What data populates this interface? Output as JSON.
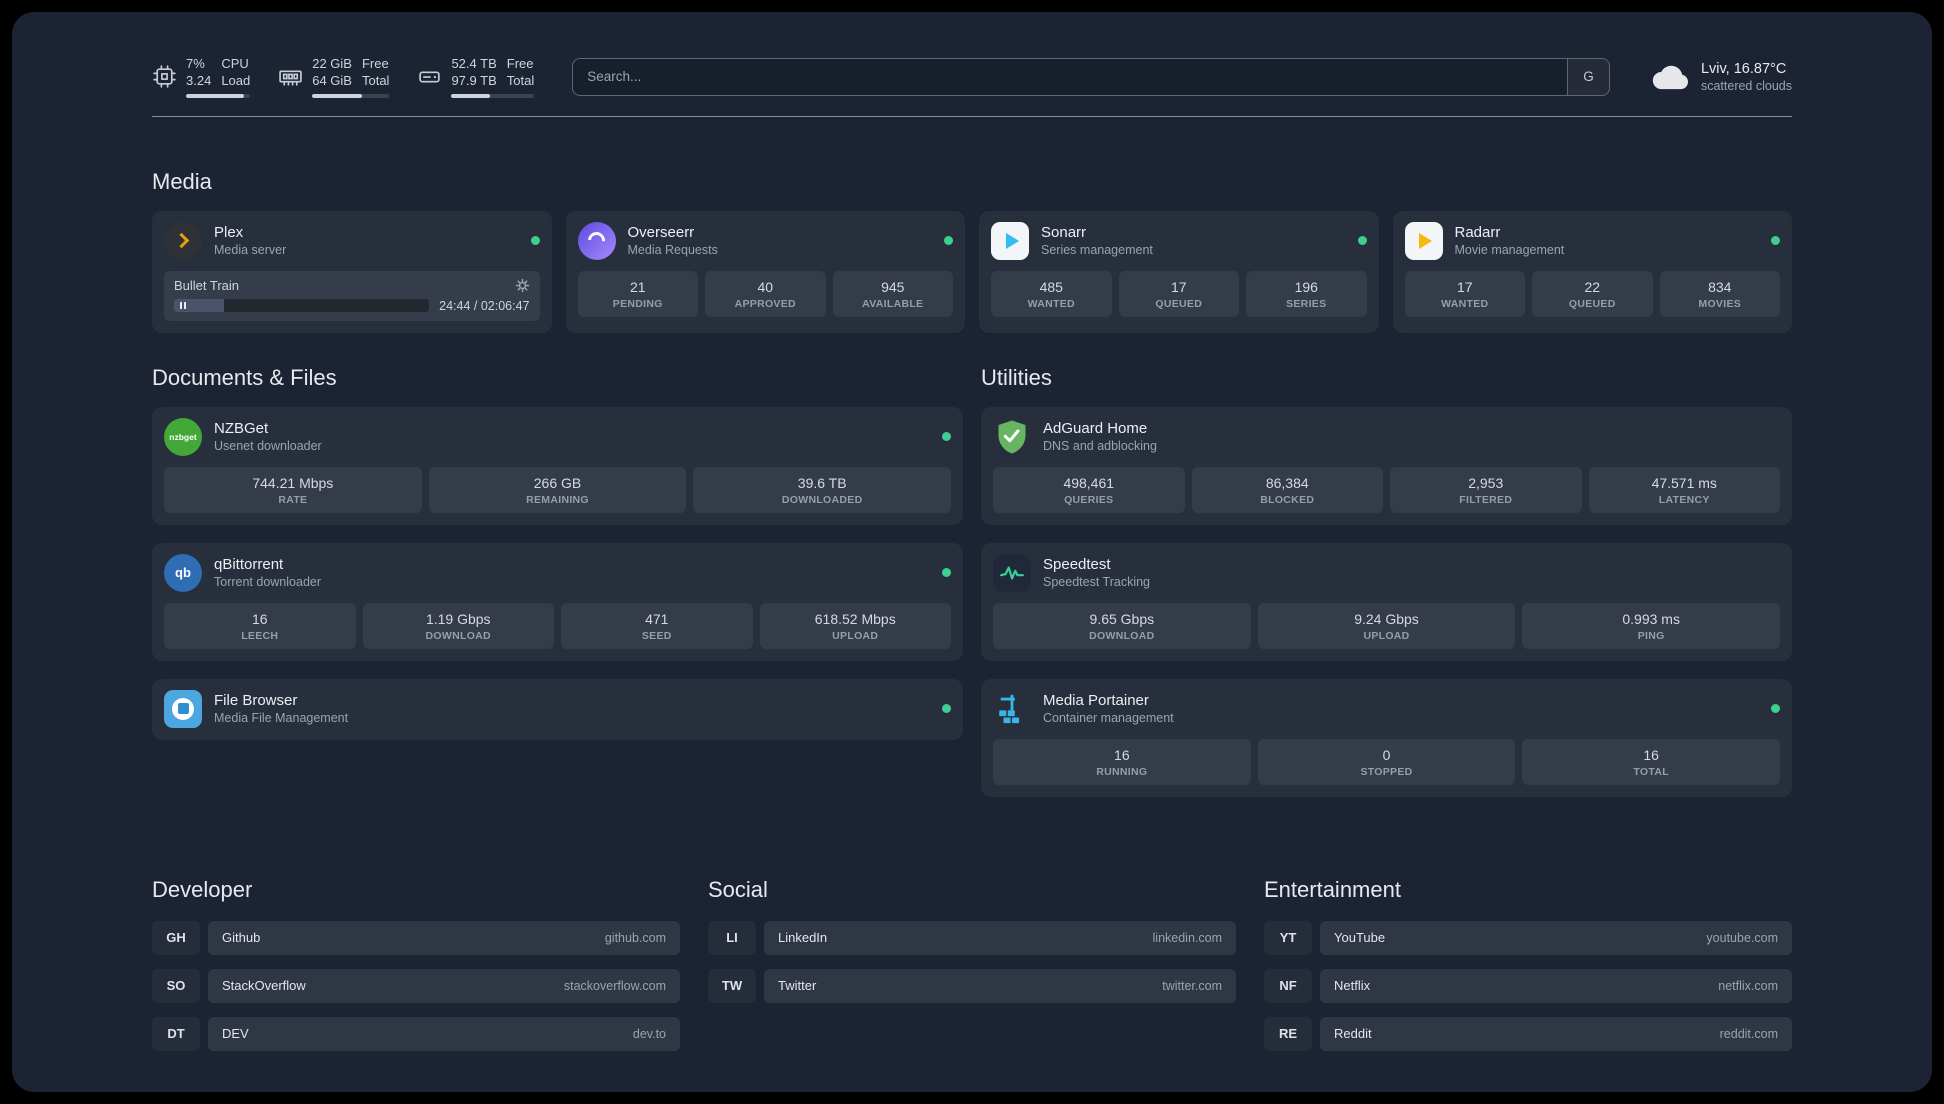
{
  "palette": {
    "background": "#1c2433",
    "status_green": "#3ecf8e",
    "plex_amber": "#e5a00d",
    "sonarr_blue": "#30bdf0",
    "radarr_yellow": "#f7b90c",
    "nzbget_green": "#44a839",
    "qbittorrent_blue": "#2f6db5",
    "filebrowser_blue": "#4ca6e0",
    "adguard_green": "#67b463",
    "speedtest_green": "#34d399",
    "portainer_blue": "#38b6e8"
  },
  "topbar": {
    "cpu": {
      "values": [
        "7%",
        "3.24"
      ],
      "labels": [
        "CPU",
        "Load"
      ],
      "percent": 90
    },
    "memory": {
      "values": [
        "22 GiB",
        "64 GiB"
      ],
      "labels": [
        "Free",
        "Total"
      ],
      "percent": 65
    },
    "disk": {
      "values": [
        "52.4 TB",
        "97.9 TB"
      ],
      "labels": [
        "Free",
        "Total"
      ],
      "percent": 46
    },
    "search": {
      "placeholder": "Search...",
      "provider": "G"
    },
    "weather": {
      "location": "Lviv, 16.87°C",
      "condition": "scattered clouds"
    }
  },
  "media": {
    "title": "Media",
    "plex": {
      "name": "Plex",
      "desc": "Media server",
      "now_playing": {
        "title": "Bullet Train",
        "time": "24:44 / 02:06:47",
        "percent": 19.5
      }
    },
    "overseerr": {
      "name": "Overseerr",
      "desc": "Media Requests",
      "stats": [
        {
          "value": "21",
          "label": "PENDING"
        },
        {
          "value": "40",
          "label": "APPROVED"
        },
        {
          "value": "945",
          "label": "AVAILABLE"
        }
      ]
    },
    "sonarr": {
      "name": "Sonarr",
      "desc": "Series management",
      "stats": [
        {
          "value": "485",
          "label": "WANTED"
        },
        {
          "value": "17",
          "label": "QUEUED"
        },
        {
          "value": "196",
          "label": "SERIES"
        }
      ]
    },
    "radarr": {
      "name": "Radarr",
      "desc": "Movie management",
      "stats": [
        {
          "value": "17",
          "label": "WANTED"
        },
        {
          "value": "22",
          "label": "QUEUED"
        },
        {
          "value": "834",
          "label": "MOVIES"
        }
      ]
    }
  },
  "documents": {
    "title": "Documents & Files",
    "nzbget": {
      "name": "NZBGet",
      "desc": "Usenet downloader",
      "icon_text": "nzbget",
      "stats": [
        {
          "value": "744.21 Mbps",
          "label": "RATE"
        },
        {
          "value": "266 GB",
          "label": "REMAINING"
        },
        {
          "value": "39.6 TB",
          "label": "DOWNLOADED"
        }
      ]
    },
    "qbittorrent": {
      "name": "qBittorrent",
      "desc": "Torrent downloader",
      "icon_text": "qb",
      "stats": [
        {
          "value": "16",
          "label": "LEECH"
        },
        {
          "value": "1.19 Gbps",
          "label": "DOWNLOAD"
        },
        {
          "value": "471",
          "label": "SEED"
        },
        {
          "value": "618.52 Mbps",
          "label": "UPLOAD"
        }
      ]
    },
    "filebrowser": {
      "name": "File Browser",
      "desc": "Media File Management"
    }
  },
  "utilities": {
    "title": "Utilities",
    "adguard": {
      "name": "AdGuard Home",
      "desc": "DNS and adblocking",
      "stats": [
        {
          "value": "498,461",
          "label": "QUERIES"
        },
        {
          "value": "86,384",
          "label": "BLOCKED"
        },
        {
          "value": "2,953",
          "label": "FILTERED"
        },
        {
          "value": "47.571 ms",
          "label": "LATENCY"
        }
      ]
    },
    "speedtest": {
      "name": "Speedtest",
      "desc": "Speedtest Tracking",
      "stats": [
        {
          "value": "9.65 Gbps",
          "label": "DOWNLOAD"
        },
        {
          "value": "9.24 Gbps",
          "label": "UPLOAD"
        },
        {
          "value": "0.993 ms",
          "label": "PING"
        }
      ]
    },
    "portainer": {
      "name": "Media Portainer",
      "desc": "Container management",
      "stats": [
        {
          "value": "16",
          "label": "RUNNING"
        },
        {
          "value": "0",
          "label": "STOPPED"
        },
        {
          "value": "16",
          "label": "TOTAL"
        }
      ]
    }
  },
  "bookmarks": {
    "developer": {
      "title": "Developer",
      "items": [
        {
          "abbr": "GH",
          "name": "Github",
          "url": "github.com"
        },
        {
          "abbr": "SO",
          "name": "StackOverflow",
          "url": "stackoverflow.com"
        },
        {
          "abbr": "DT",
          "name": "DEV",
          "url": "dev.to"
        }
      ]
    },
    "social": {
      "title": "Social",
      "items": [
        {
          "abbr": "LI",
          "name": "LinkedIn",
          "url": "linkedin.com"
        },
        {
          "abbr": "TW",
          "name": "Twitter",
          "url": "twitter.com"
        }
      ]
    },
    "entertainment": {
      "title": "Entertainment",
      "items": [
        {
          "abbr": "YT",
          "name": "YouTube",
          "url": "youtube.com"
        },
        {
          "abbr": "NF",
          "name": "Netflix",
          "url": "netflix.com"
        },
        {
          "abbr": "RE",
          "name": "Reddit",
          "url": "reddit.com"
        }
      ]
    }
  }
}
